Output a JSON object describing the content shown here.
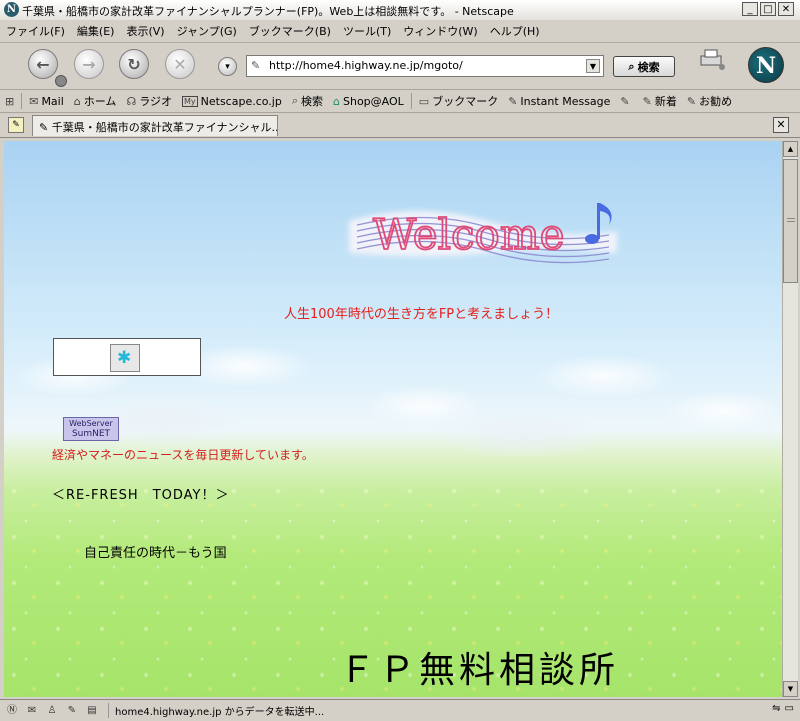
{
  "window": {
    "title": "千葉県・船橋市の家計改革ファイナンシャルプランナー(FP)。Web上は相談無料です。 - Netscape",
    "app_icon": "N"
  },
  "menu": [
    "ファイル(F)",
    "編集(E)",
    "表示(V)",
    "ジャンプ(G)",
    "ブックマーク(B)",
    "ツール(T)",
    "ウィンドウ(W)",
    "ヘルプ(H)"
  ],
  "nav": {
    "url": "http://home4.highway.ne.jp/mgoto/",
    "search_label": "検索"
  },
  "bookmarks": [
    {
      "icon": "✉",
      "label": "Mail"
    },
    {
      "icon": "⌂",
      "label": "ホーム"
    },
    {
      "icon": "☊",
      "label": "ラジオ"
    },
    {
      "icon": "My",
      "label": "Netscape.co.jp"
    },
    {
      "icon": "⌕",
      "label": "検索"
    },
    {
      "icon": "⌂",
      "label": "Shop@AOL"
    },
    {
      "icon": "▭",
      "label": "ブックマーク"
    },
    {
      "icon": "✎",
      "label": "Instant Message"
    },
    {
      "icon": "✎",
      "label": ""
    },
    {
      "icon": "✎",
      "label": "新着"
    },
    {
      "icon": "✎",
      "label": "お勧め"
    }
  ],
  "tab": {
    "label": "千葉県・船橋市の家計改革ファイナンシャル..."
  },
  "page": {
    "welcome_text": "Welcome",
    "tagline": "人生100年時代の生き方をFPと考えましょう！",
    "badge_line1": "WebServer",
    "badge_line2": "SumNET",
    "news": "経済やマネーのニュースを毎日更新しています。",
    "refresh": "＜RE-FRESH　TODAY！＞",
    "jiko": "自己責任の時代－もう国",
    "fp_title": "ＦＰ無料相談所"
  },
  "status": {
    "text": "home4.highway.ne.jp からデータを転送中..."
  },
  "colors": {
    "tagline": "#e4201c",
    "news": "#d41e1e",
    "badge_bg": "#c8c4ec"
  }
}
